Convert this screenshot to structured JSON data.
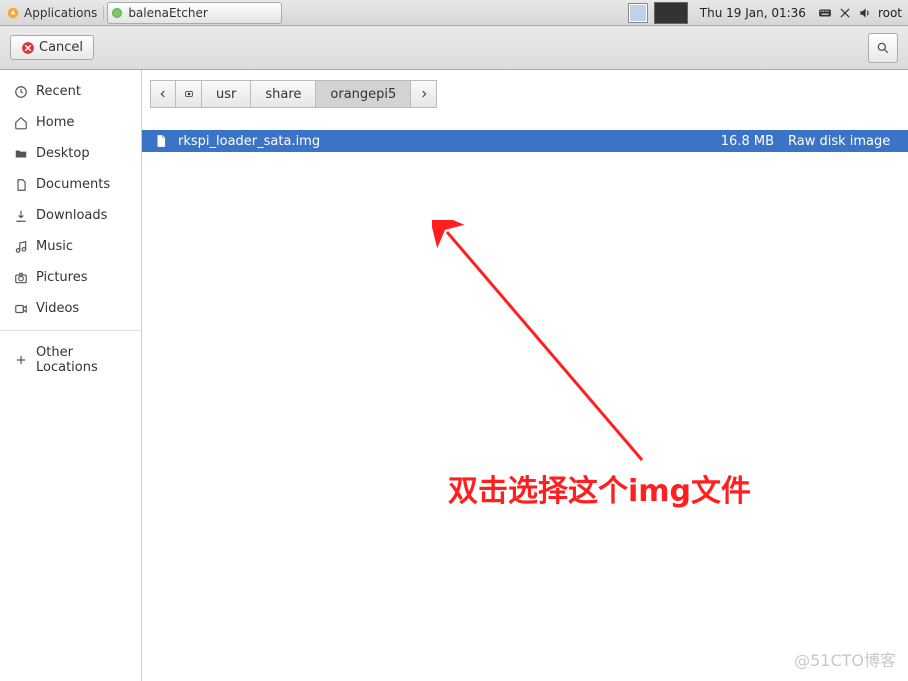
{
  "panel": {
    "applications_label": "Applications",
    "task_title": "balenaEtcher",
    "clock": "Thu 19 Jan, 01:36",
    "user": "root"
  },
  "toolbar": {
    "cancel_label": "Cancel"
  },
  "sidebar": {
    "items": [
      {
        "key": "recent",
        "label": "Recent"
      },
      {
        "key": "home",
        "label": "Home"
      },
      {
        "key": "desktop",
        "label": "Desktop"
      },
      {
        "key": "documents",
        "label": "Documents"
      },
      {
        "key": "downloads",
        "label": "Downloads"
      },
      {
        "key": "music",
        "label": "Music"
      },
      {
        "key": "pictures",
        "label": "Pictures"
      },
      {
        "key": "videos",
        "label": "Videos"
      }
    ],
    "other_locations_label": "Other Locations"
  },
  "path": {
    "segments": [
      "usr",
      "share",
      "orangepi5"
    ],
    "active_index": 2
  },
  "files": [
    {
      "name": "rkspi_loader_sata.img",
      "size": "16.8 MB",
      "type": "Raw disk image"
    }
  ],
  "annotation": {
    "text": "双击选择这个img文件",
    "color": "#ff1f1f"
  },
  "watermark": "@51CTO博客"
}
